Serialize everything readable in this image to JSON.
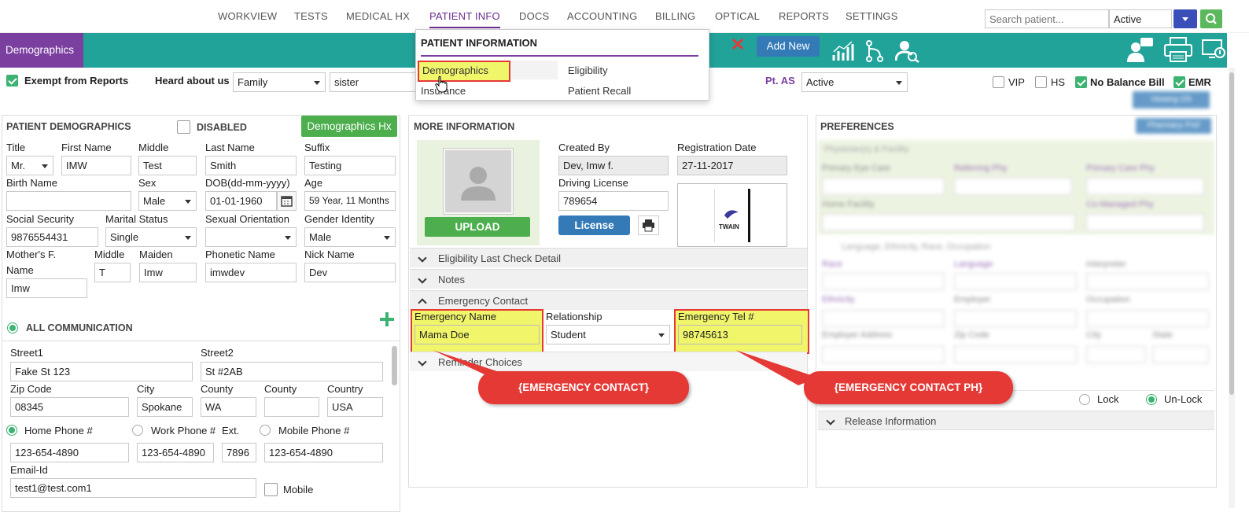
{
  "nav": {
    "items": [
      "WORKVIEW",
      "TESTS",
      "MEDICAL HX",
      "PATIENT INFO",
      "DOCS",
      "ACCOUNTING",
      "BILLING",
      "OPTICAL",
      "REPORTS",
      "SETTINGS"
    ],
    "search_placeholder": "Search patient...",
    "status_value": "Active"
  },
  "dropdown": {
    "title": "PATIENT INFORMATION",
    "items": [
      "Demographics",
      "Eligibility",
      "Insurance",
      "Patient Recall"
    ]
  },
  "toolbar": {
    "tab": "Demographics",
    "add_new": "Add New"
  },
  "topbar": {
    "exempt_label": "Exempt from Reports",
    "heard_label": "Heard about us",
    "heard_value": "Family",
    "heard_detail": "sister",
    "pt_as_label": "Pt. AS",
    "pt_as_value": "Active",
    "vip": "VIP",
    "hs": "HS",
    "no_balance": "No Balance Bill",
    "emr": "EMR"
  },
  "demographics": {
    "header": "PATIENT DEMOGRAPHICS",
    "disabled": "DISABLED",
    "hx_button": "Demographics Hx",
    "labels": {
      "title": "Title",
      "first": "First Name",
      "middle": "Middle",
      "last": "Last Name",
      "suffix": "Suffix",
      "birth": "Birth Name",
      "sex": "Sex",
      "dob": "DOB(dd-mm-yyyy)",
      "age": "Age",
      "ssn": "Social Security",
      "marital": "Marital Status",
      "orientation": "Sexual Orientation",
      "gender": "Gender Identity",
      "mother1": "Mother's F.",
      "mother2": "Name",
      "mmiddle": "Middle",
      "maiden": "Maiden",
      "phonetic": "Phonetic Name",
      "nick": "Nick Name"
    },
    "values": {
      "title": "Mr.",
      "first": "IMW",
      "middle": "Test",
      "last": "Smith",
      "suffix": "Testing",
      "birth": "",
      "sex": "Male",
      "dob": "01-01-1960",
      "age": "59 Year, 11 Months",
      "ssn": "9876554431",
      "marital": "Single",
      "orientation": "",
      "gender": "Male",
      "mother": "Imw",
      "mmiddle": "T",
      "maiden": "Imw",
      "phonetic": "imwdev",
      "nick": "Dev"
    },
    "all_comm": "ALL COMMUNICATION",
    "address": {
      "street1_label": "Street1",
      "street1": "Fake St 123",
      "street2_label": "Street2",
      "street2": "St #2AB",
      "zip_label": "Zip Code",
      "zip": "08345",
      "city_label": "City",
      "city": "Spokane",
      "county_label": "County",
      "county": "WA",
      "county2_label": "County",
      "county2": "",
      "country_label": "Country",
      "country": "USA"
    },
    "phones": {
      "home_label": "Home Phone #",
      "home": "123-654-4890",
      "work_label": "Work Phone #",
      "work": "123-654-4890",
      "ext_label": "Ext.",
      "ext": "7896",
      "mobile_label": "Mobile Phone #",
      "mobile": "123-654-4890"
    },
    "email_label": "Email-Id",
    "email": "test1@test.com1",
    "mobile_cb": "Mobile"
  },
  "more": {
    "header": "MORE INFORMATION",
    "upload": "UPLOAD",
    "created_by_label": "Created By",
    "created_by": "Dev, Imw f.",
    "reg_date_label": "Registration Date",
    "reg_date": "27-11-2017",
    "driving_label": "Driving License",
    "driving": "789654",
    "license_btn": "License",
    "twain": "TWAIN",
    "accordion": [
      "Eligibility Last Check Detail",
      "Notes",
      "Emergency Contact",
      "Reminder Choices"
    ],
    "em_name_label": "Emergency Name",
    "em_name": "Mama Doe",
    "relationship_label": "Relationship",
    "relationship": "Student",
    "em_tel_label": "Emergency Tel #",
    "em_tel": "98745613"
  },
  "callouts": {
    "contact": "{EMERGENCY CONTACT}",
    "phone": "{EMERGENCY CONTACT PH}"
  },
  "prefs": {
    "header": "PREFERENCES",
    "lock": "Lock",
    "unlock": "Un-Lock",
    "release": "Release Information",
    "blurred": [
      "Physician(s) & Facility",
      "Primary Eye Care",
      "Referring Phy",
      "Primary Care Phy",
      "Home Facility",
      "Co-Managed Phy",
      "Language, Ethnicity, Race, Occupation",
      "Race",
      "Language",
      "Interpreter",
      "Ethnicity",
      "Employer",
      "Occupation",
      "Employer Address",
      "Zip Code",
      "City",
      "State",
      "Viewing OS",
      "Pharmacy Pref"
    ]
  },
  "colors": {
    "teal": "#21a39a",
    "purple": "#7b3fa0",
    "green": "#4cae4c",
    "blue": "#337ab7",
    "highlight": "#f0f56a",
    "callout": "#e53935"
  }
}
